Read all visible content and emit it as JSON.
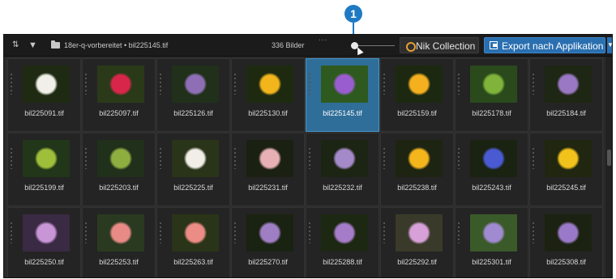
{
  "callout": {
    "number": "1"
  },
  "toolbar": {
    "sort_glyph": "⇅",
    "filter_glyph": "▼",
    "path": "18er-q-vorbereitet • bil225145.tif",
    "count": "336 Bilder",
    "drag_dots": "...",
    "nik_label": "Nik Collection",
    "export_label": "Export nach Applikation",
    "export_arrow": "▼"
  },
  "thumbnail_size": 0.1,
  "colors": {
    "accent": "#2a6fb0",
    "selection": "#2f6e99"
  },
  "thumbnails": [
    {
      "name": "bil225091.tif",
      "bg": "#1f2a12",
      "flower": "#f0f0e8",
      "selected": false
    },
    {
      "name": "bil225097.tif",
      "bg": "#2a3a18",
      "flower": "#d8264a",
      "selected": false
    },
    {
      "name": "bil225126.tif",
      "bg": "#20301a",
      "flower": "#8e6fb6",
      "selected": false
    },
    {
      "name": "bil225130.tif",
      "bg": "#1e2a10",
      "flower": "#f2b51c",
      "selected": false
    },
    {
      "name": "bil225145.tif",
      "bg": "#2e5a20",
      "flower": "#9a5dcf",
      "selected": true
    },
    {
      "name": "bil225159.tif",
      "bg": "#1c2810",
      "flower": "#f5b020",
      "selected": false
    },
    {
      "name": "bil225178.tif",
      "bg": "#2a4a1c",
      "flower": "#7fb33a",
      "selected": false
    },
    {
      "name": "bil225184.tif",
      "bg": "#1e2614",
      "flower": "#9a78c4",
      "selected": false
    },
    {
      "name": "bil225199.tif",
      "bg": "#22361a",
      "flower": "#9fbf3a",
      "selected": false
    },
    {
      "name": "bil225203.tif",
      "bg": "#20301a",
      "flower": "#8fae40",
      "selected": false
    },
    {
      "name": "bil225225.tif",
      "bg": "#2a3418",
      "flower": "#f0eee6",
      "selected": false
    },
    {
      "name": "bil225231.tif",
      "bg": "#1a2012",
      "flower": "#e8b0b4",
      "selected": false
    },
    {
      "name": "bil225232.tif",
      "bg": "#1c2414",
      "flower": "#a48ac8",
      "selected": false
    },
    {
      "name": "bil225238.tif",
      "bg": "#1e2412",
      "flower": "#f5b51c",
      "selected": false
    },
    {
      "name": "bil225243.tif",
      "bg": "#1a2212",
      "flower": "#4a5ad2",
      "selected": false
    },
    {
      "name": "bil225245.tif",
      "bg": "#20260f",
      "flower": "#f2c21c",
      "selected": false
    },
    {
      "name": "bil225250.tif",
      "bg": "#3a2a44",
      "flower": "#c895d6",
      "selected": false
    },
    {
      "name": "bil225253.tif",
      "bg": "#2a3a20",
      "flower": "#e88a86",
      "selected": false
    },
    {
      "name": "bil225263.tif",
      "bg": "#2a3418",
      "flower": "#ec8c86",
      "selected": false
    },
    {
      "name": "bil225270.tif",
      "bg": "#1a2212",
      "flower": "#9f7fc4",
      "selected": false
    },
    {
      "name": "bil225288.tif",
      "bg": "#1c2812",
      "flower": "#a57cc8",
      "selected": false
    },
    {
      "name": "bil225292.tif",
      "bg": "#3a3a2a",
      "flower": "#d8a0d8",
      "selected": false
    },
    {
      "name": "bil225301.tif",
      "bg": "#3a5a2a",
      "flower": "#a08ad0",
      "selected": false
    },
    {
      "name": "bil225308.tif",
      "bg": "#1c2212",
      "flower": "#9a7ac8",
      "selected": false
    }
  ]
}
